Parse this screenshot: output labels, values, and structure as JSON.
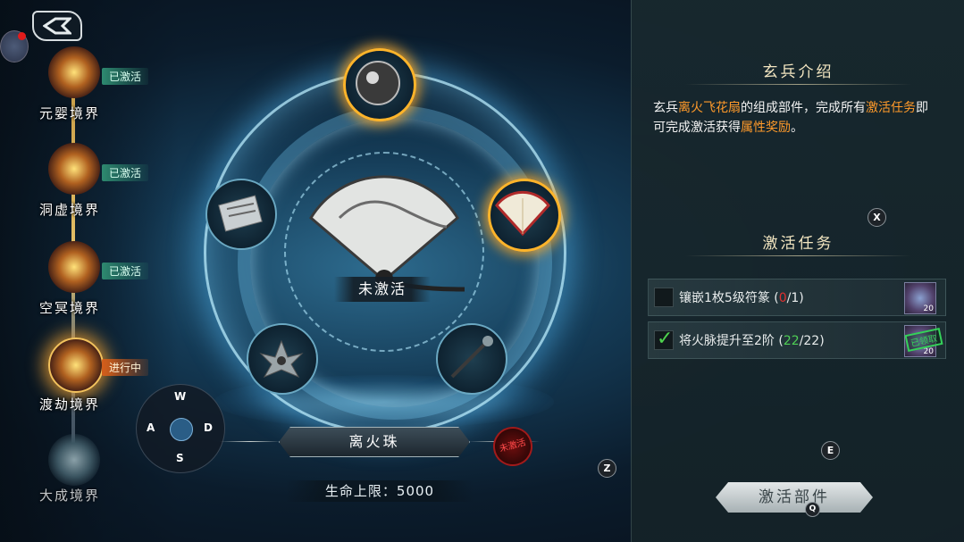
{
  "nav": {
    "back_icon": "back-arrow-icon",
    "avatar_icon": "avatar-icon"
  },
  "realms": [
    {
      "name": "元婴境界",
      "badge": "已激活",
      "state": "activated"
    },
    {
      "name": "洞虚境界",
      "badge": "已激活",
      "state": "activated"
    },
    {
      "name": "空冥境界",
      "badge": "已激活",
      "state": "activated"
    },
    {
      "name": "渡劫境界",
      "badge": "进行中",
      "state": "in-progress"
    },
    {
      "name": "大成境界",
      "badge": "",
      "state": "locked"
    }
  ],
  "wheel": {
    "center_status": "未激活",
    "selected_part_name": "离火珠",
    "part_seal": "未激活",
    "attribute_label": "生命上限：5000",
    "parts": [
      "orb",
      "scroll",
      "fan",
      "lotus",
      "whisk"
    ]
  },
  "joystick": {
    "up": "W",
    "left": "A",
    "right": "D",
    "down": "S"
  },
  "hotkeys": {
    "x": "X",
    "z": "Z",
    "e": "E",
    "q": "Q"
  },
  "panel": {
    "intro_title": "玄兵介绍",
    "intro": {
      "p1": "玄兵",
      "weapon": "离火飞花扇",
      "p2": "的组成部件，完成所有",
      "tasks_link": "激活任务",
      "p3": "即可完成激活获得",
      "reward_link": "属性奖励",
      "p4": "。"
    },
    "tasks_title": "激活任务",
    "tasks": [
      {
        "text": "镶嵌1枚5级符篆 (",
        "current": "0",
        "total": "/1)",
        "done": false,
        "reward_count": "20"
      },
      {
        "text": "将火脉提升至2阶 (",
        "current": "22",
        "total": "/22)",
        "done": true,
        "reward_count": "20",
        "stamp": "已领取"
      }
    ],
    "activate_button": "激活部件"
  },
  "colors": {
    "highlight": "#ff9a2a",
    "progress_red": "#e12f2f",
    "progress_green": "#4fcf55",
    "gold": "#ffb42a"
  }
}
